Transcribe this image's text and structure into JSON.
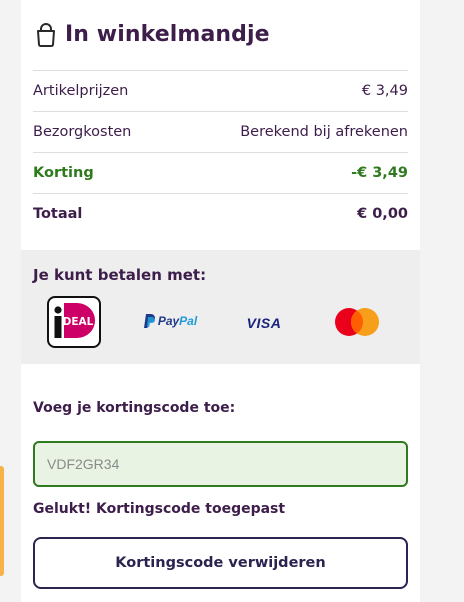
{
  "cart": {
    "title": "In winkelmandje",
    "icon": "shopping-bag-icon",
    "rows": [
      {
        "label": "Artikelprijzen",
        "value": "€ 3,49"
      },
      {
        "label": "Bezorgkosten",
        "value": "Berekend bij afrekenen"
      },
      {
        "label": "Korting",
        "value": "-€ 3,49"
      },
      {
        "label": "Totaal",
        "value": "€ 0,00"
      }
    ]
  },
  "payment": {
    "title": "Je kunt betalen met:",
    "methods": [
      {
        "icon": "ideal-logo",
        "text": "DEAL"
      },
      {
        "icon": "paypal-logo",
        "text_a": "Pay",
        "text_b": "Pal"
      },
      {
        "icon": "visa-logo",
        "text": "VISA"
      },
      {
        "icon": "mastercard-logo"
      }
    ]
  },
  "discount": {
    "label": "Voeg je kortingscode toe:",
    "code_value": "VDF2GR34",
    "success_message": "Gelukt! Kortingscode toegepast",
    "remove_label": "Kortingscode verwijderen"
  },
  "colors": {
    "text": "#3d1d4a",
    "discount_green": "#2f7a1e",
    "input_bg": "#e8f3e4",
    "button_border": "#2b2350"
  }
}
